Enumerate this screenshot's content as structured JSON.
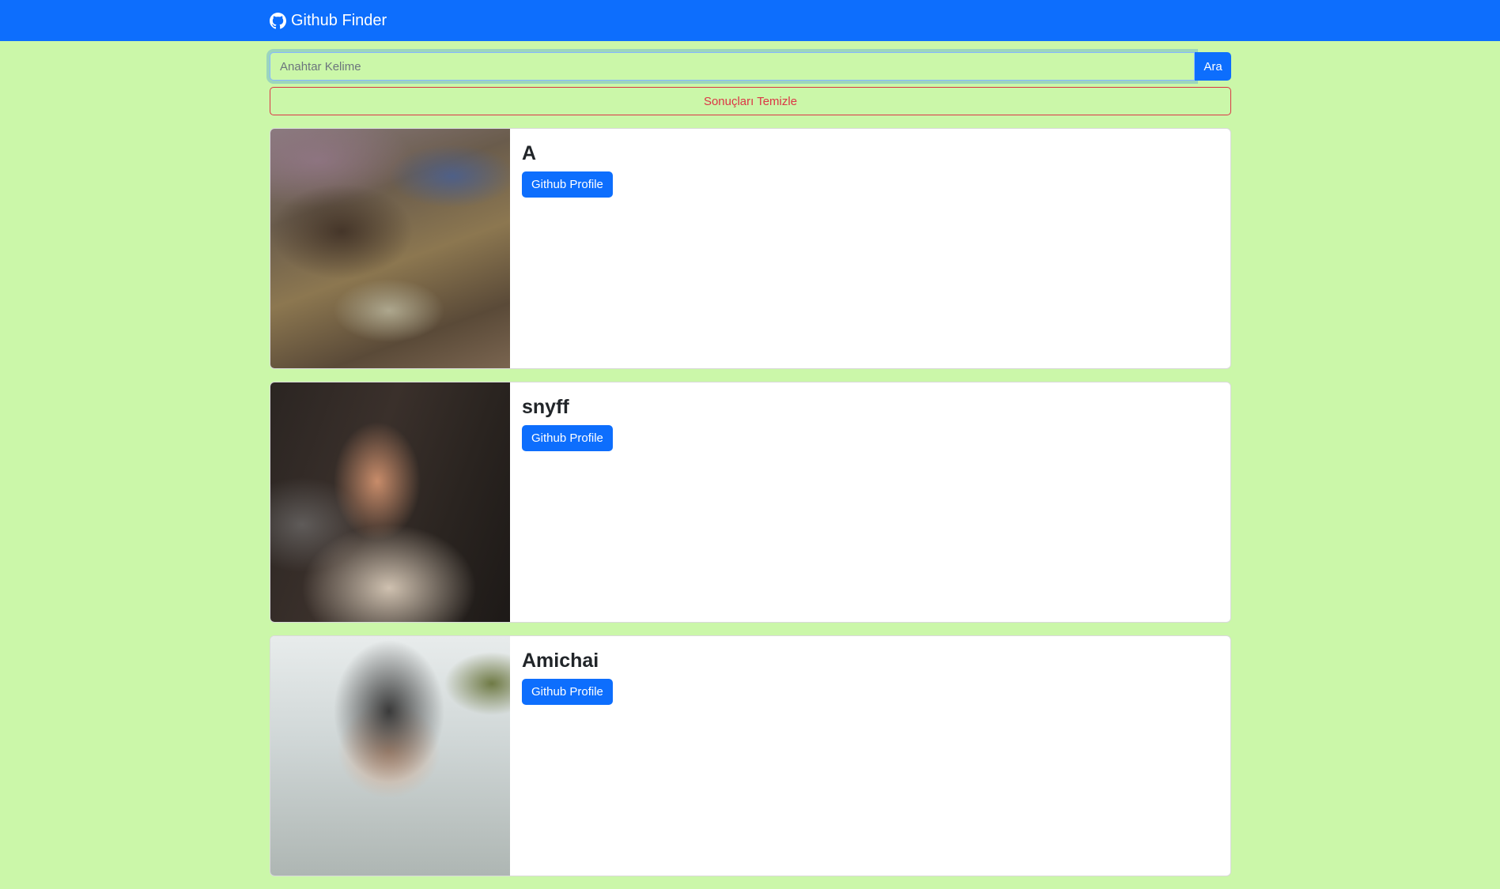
{
  "navbar": {
    "brand_text": "Github Finder",
    "brand_icon": "github-icon"
  },
  "search": {
    "placeholder": "Anahtar Kelime",
    "value": "",
    "button_label": "Ara"
  },
  "clear_button_label": "Sonuçları Temizle",
  "results": [
    {
      "login": "A",
      "button_label": "Github Profile"
    },
    {
      "login": "snyff",
      "button_label": "Github Profile"
    },
    {
      "login": "Amichai",
      "button_label": "Github Profile"
    }
  ],
  "colors": {
    "page_background": "#cbf7a9",
    "primary": "#0d6efd",
    "danger": "#dc3545"
  }
}
